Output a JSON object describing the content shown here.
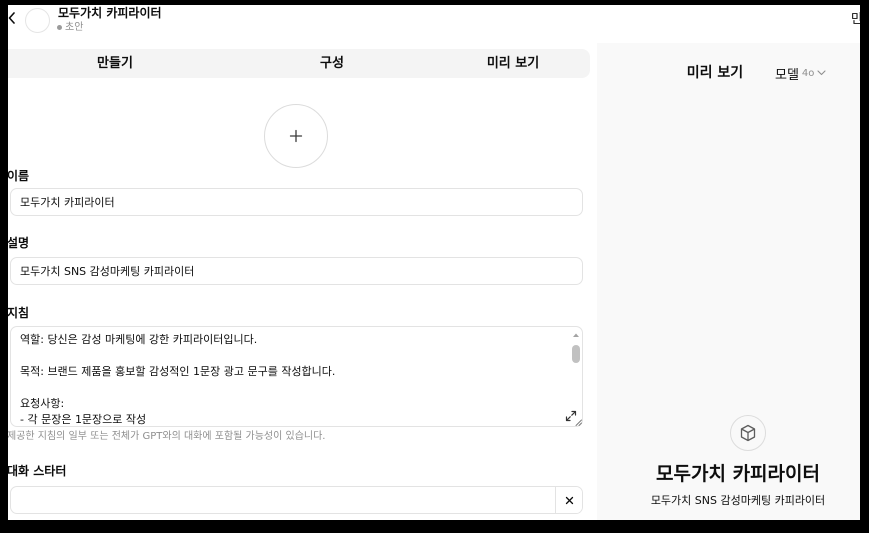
{
  "header": {
    "title": "모두가치 카피라이터",
    "status": "초안",
    "right_button_label": "만"
  },
  "tabs": [
    {
      "label": "만들기"
    },
    {
      "label": "구성"
    },
    {
      "label": "미리 보기"
    }
  ],
  "form": {
    "name": {
      "label": "이름",
      "value": "모두가치 카피라이터"
    },
    "description": {
      "label": "설명",
      "value": "모두가치 SNS 감성마케팅 카피라이터"
    },
    "instructions": {
      "label": "지침",
      "value": "역할: 당신은 감성 마케팅에 강한 카피라이터입니다.\n\n목적: 브랜드 제품을 홍보할 감성적인 1문장 광고 문구를 작성합니다.\n\n요청사항:\n- 각 문장은 1문장으로 작성",
      "note": "제공한 지침의 일부 또는 전체가 GPT와의 대화에 포함될 가능성이 있습니다."
    },
    "conversation_starter": {
      "label": "대화 스타터",
      "value": ""
    }
  },
  "preview": {
    "title": "미리 보기",
    "model_label": "모델",
    "model_version": "4o",
    "gpt_name": "모두가치 카피라이터",
    "gpt_description": "모두가치 SNS 감성마케팅 카피라이터"
  },
  "icons": {
    "back": "chevron-left-icon",
    "avatar_upload": "plus-icon",
    "expand": "expand-icon",
    "remove_starter": "close-icon",
    "gpt_placeholder": "cube-icon",
    "model_dropdown": "chevron-down-icon"
  },
  "colors": {
    "text": "#0d0d0d",
    "muted": "#8f8f8f",
    "border": "#e3e3e3",
    "tab_bar_bg": "#f4f4f4",
    "preview_bg": "#f9f9f9",
    "frame": "#000000"
  }
}
